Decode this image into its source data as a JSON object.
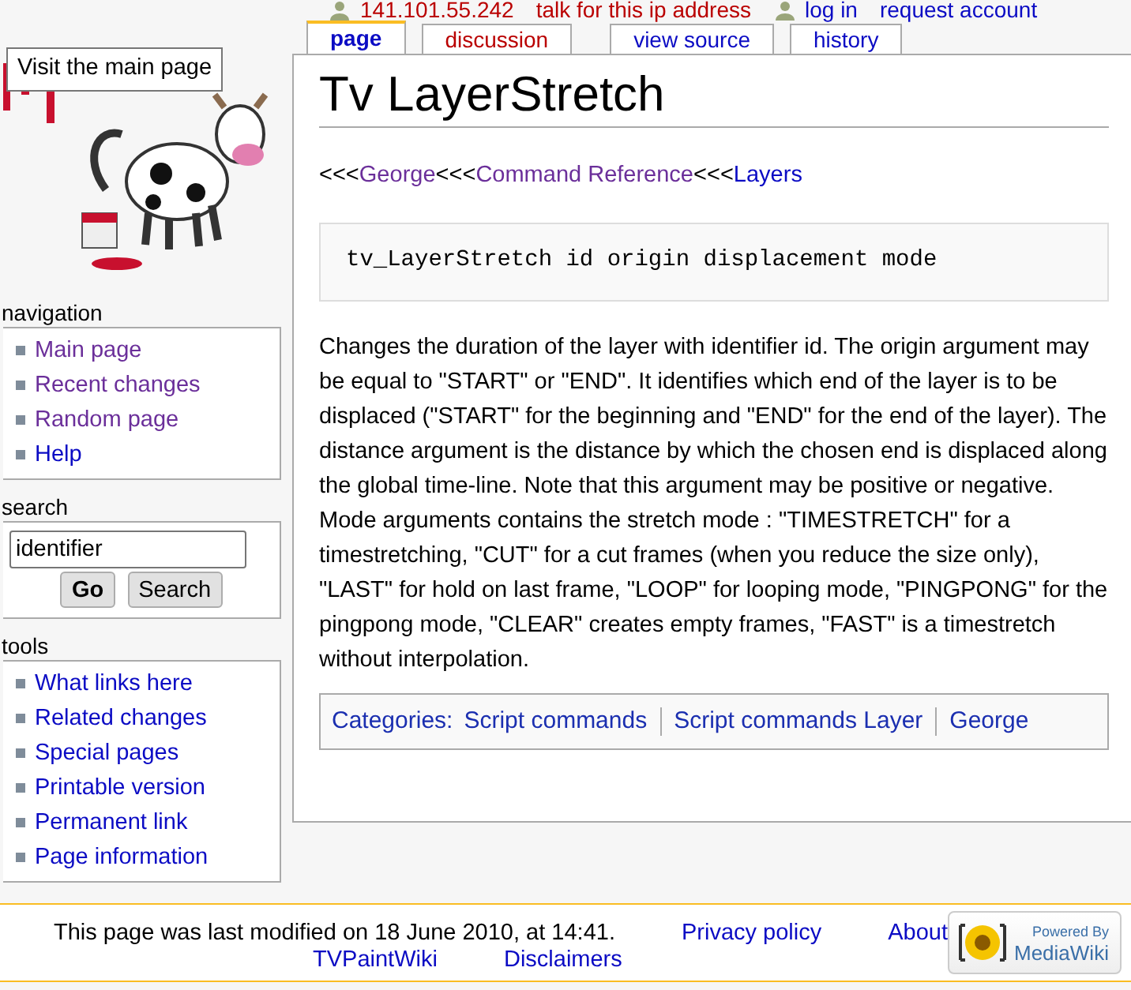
{
  "personal_tools": [
    {
      "label": "141.101.55.242",
      "kind": "user",
      "missing": true
    },
    {
      "label": "talk for this ip address",
      "kind": "link",
      "missing": true
    },
    {
      "label": "log in",
      "kind": "user",
      "missing": false
    },
    {
      "label": "request account",
      "kind": "link",
      "missing": false
    }
  ],
  "logo_tooltip": "Visit the main page",
  "tabs": [
    {
      "label": "page",
      "selected": true,
      "missing": false
    },
    {
      "label": "discussion",
      "selected": false,
      "missing": true
    },
    {
      "label": "view source",
      "selected": false,
      "missing": false
    },
    {
      "label": "history",
      "selected": false,
      "missing": false
    }
  ],
  "title": "Tv LayerStretch",
  "breadcrumb": [
    {
      "text": "<<<",
      "kind": "text"
    },
    {
      "text": "George",
      "kind": "link",
      "visited": true
    },
    {
      "text": "<<<",
      "kind": "text"
    },
    {
      "text": "Command Reference",
      "kind": "link",
      "visited": true
    },
    {
      "text": "<<<",
      "kind": "text"
    },
    {
      "text": "Layers",
      "kind": "link",
      "visited": false
    }
  ],
  "code": "tv_LayerStretch id origin displacement mode",
  "description": "Changes the duration of the layer with identifier id. The origin argument may be equal to \"START\" or \"END\". It identifies which end of the layer is to be displaced (\"START\" for the beginning and \"END\" for the end of the layer). The distance argument is the distance by which the chosen end is displaced along the global time-line. Note that this argument may be positive or negative. Mode arguments contains the stretch mode : \"TIMESTRETCH\" for a timestretching, \"CUT\" for a cut frames (when you reduce the size only), \"LAST\" for hold on last frame, \"LOOP\" for looping mode, \"PINGPONG\" for the pingpong mode, \"CLEAR\" creates empty frames, \"FAST\" is a timestretch without interpolation.",
  "categories": {
    "label": "Categories:",
    "items": [
      "Script commands",
      "Script commands Layer",
      "George"
    ]
  },
  "navigation": {
    "heading": "navigation",
    "items": [
      {
        "label": "Main page",
        "visited": true
      },
      {
        "label": "Recent changes",
        "visited": true
      },
      {
        "label": "Random page",
        "visited": true
      },
      {
        "label": "Help",
        "visited": false
      }
    ]
  },
  "search": {
    "heading": "search",
    "value": "identifier",
    "buttons": [
      {
        "label": "Go",
        "kind": "primary"
      },
      {
        "label": "Search",
        "kind": "secondary"
      }
    ]
  },
  "tools": {
    "heading": "tools",
    "items": [
      {
        "label": "What links here",
        "visited": false
      },
      {
        "label": "Related changes",
        "visited": false
      },
      {
        "label": "Special pages",
        "visited": false
      },
      {
        "label": "Printable version",
        "visited": false
      },
      {
        "label": "Permanent link",
        "visited": false
      },
      {
        "label": "Page information",
        "visited": false
      }
    ]
  },
  "footer": {
    "modified": "This page was last modified on 18 June 2010, at 14:41.",
    "links": [
      "Privacy policy",
      "About",
      "TVPaintWiki",
      "Disclaimers"
    ],
    "badge_top": "Powered By",
    "badge_bottom": "MediaWiki"
  }
}
